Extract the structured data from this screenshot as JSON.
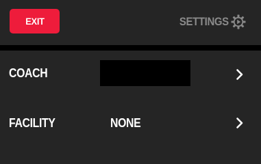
{
  "header": {
    "exit_label": "EXIT",
    "settings_label": "SETTINGS",
    "settings_icon": "gear-play-icon"
  },
  "rows": [
    {
      "label": "COACH",
      "value": "",
      "value_redacted": true,
      "chevron_icon": "chevron-right-icon"
    },
    {
      "label": "FACILITY",
      "value": "NONE",
      "chevron_icon": "chevron-right-icon"
    }
  ],
  "colors": {
    "background": "#252525",
    "divider": "#000000",
    "exit_button": "#ee1c3b",
    "settings_text": "#8a8a8a",
    "text": "#ffffff"
  }
}
